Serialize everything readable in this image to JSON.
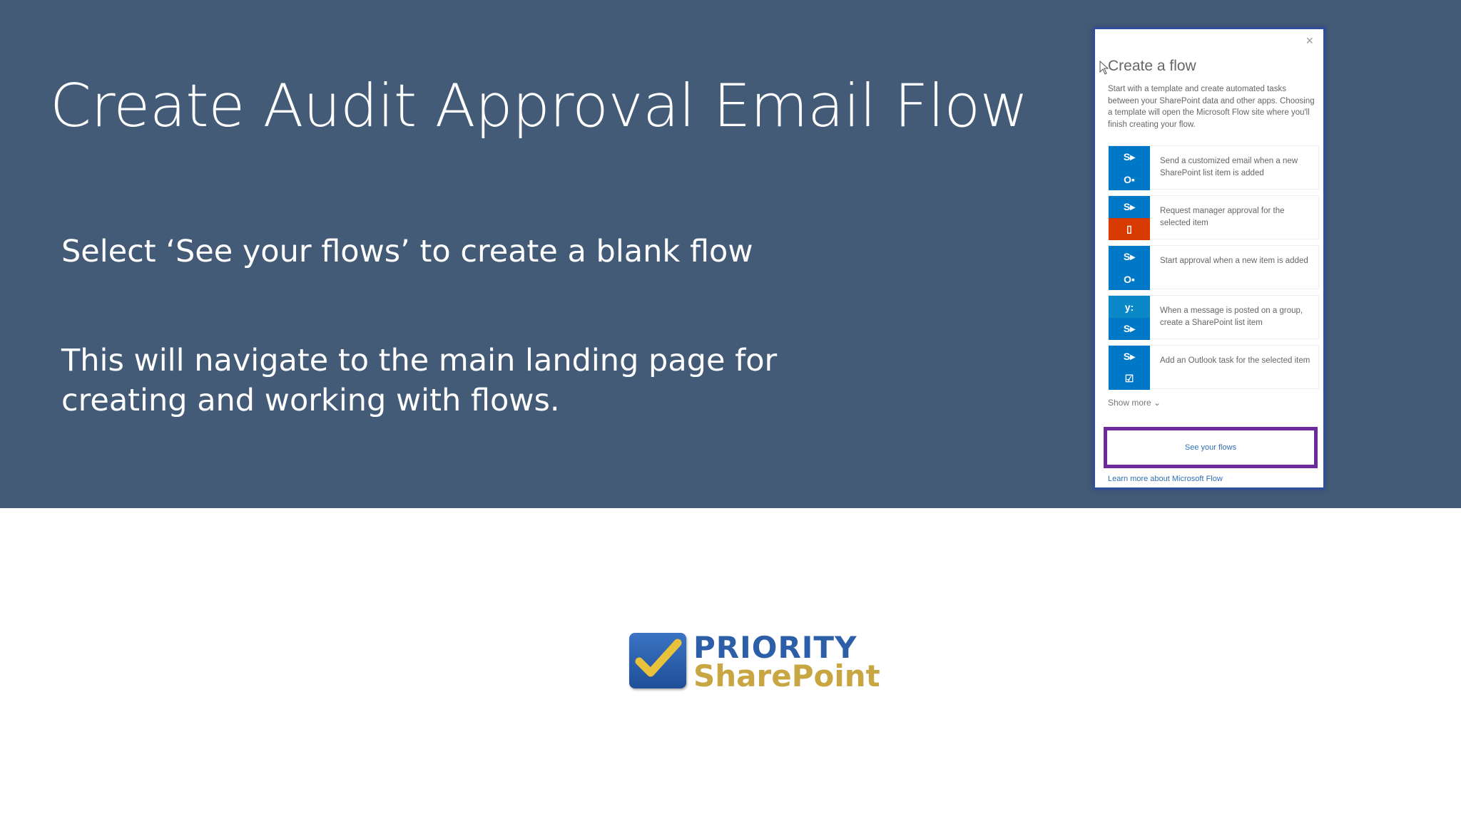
{
  "slide": {
    "title": "Create Audit Approval Email Flow",
    "bullets": [
      "Select ‘See your flows’ to create a blank flow",
      "This will navigate to the main landing page for creating and working with flows."
    ]
  },
  "flow_panel": {
    "close": "×",
    "title": "Create a flow",
    "description": "Start with a template and create automated tasks between your SharePoint data and other apps. Choosing a template will open the Microsoft Flow site where you'll finish creating your flow.",
    "templates": [
      {
        "label": "Send a customized email when a new SharePoint list item is added",
        "top_icon": "sharepoint-icon",
        "bottom_icon": "outlook-icon"
      },
      {
        "label": "Request manager approval for the selected item",
        "top_icon": "sharepoint-icon",
        "bottom_icon": "office-icon"
      },
      {
        "label": "Start approval when a new item is added",
        "top_icon": "sharepoint-icon",
        "bottom_icon": "outlook-icon"
      },
      {
        "label": "When a message is posted on a group, create a SharePoint list item",
        "top_icon": "yammer-icon",
        "bottom_icon": "sharepoint-icon"
      },
      {
        "label": "Add an Outlook task for the selected item",
        "top_icon": "sharepoint-icon",
        "bottom_icon": "checkbox-icon"
      }
    ],
    "show_more": "Show more",
    "see_flows": "See your flows",
    "learn_more": "Learn more about Microsoft Flow"
  },
  "logo": {
    "line1": "PRIORITY",
    "line2": "SharePoint"
  },
  "colors": {
    "banner": "#445b77",
    "highlight_border": "#6b2a9e",
    "link": "#2f6fb5"
  }
}
